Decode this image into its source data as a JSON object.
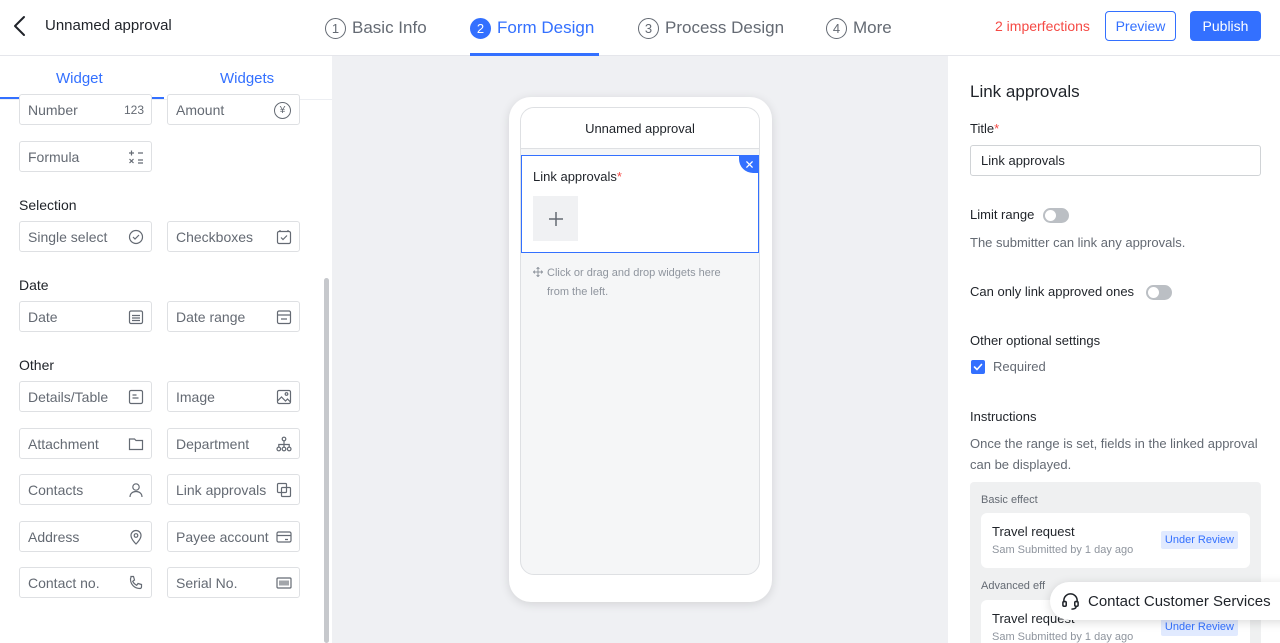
{
  "header": {
    "title": "Unnamed approval",
    "steps": [
      {
        "num": "1",
        "label": "Basic Info"
      },
      {
        "num": "2",
        "label": "Form Design"
      },
      {
        "num": "3",
        "label": "Process Design"
      },
      {
        "num": "4",
        "label": "More"
      }
    ],
    "imperfections": "2 imperfections",
    "preview": "Preview",
    "publish": "Publish"
  },
  "left": {
    "tabs": [
      "Widget",
      "Widgets"
    ],
    "sections": {
      "selection": "Selection",
      "date": "Date",
      "other": "Other"
    },
    "widgets": {
      "number": {
        "label": "Number",
        "icon": "123"
      },
      "amount": {
        "label": "Amount",
        "icon": "¥"
      },
      "formula": {
        "label": "Formula"
      },
      "single_select": {
        "label": "Single select"
      },
      "checkboxes": {
        "label": "Checkboxes"
      },
      "date": {
        "label": "Date"
      },
      "date_range": {
        "label": "Date range"
      },
      "details_table": {
        "label": "Details/Table"
      },
      "image": {
        "label": "Image"
      },
      "attachment": {
        "label": "Attachment"
      },
      "department": {
        "label": "Department"
      },
      "contacts": {
        "label": "Contacts"
      },
      "link_approvals": {
        "label": "Link approvals"
      },
      "address": {
        "label": "Address"
      },
      "payee_account": {
        "label": "Payee account"
      },
      "contact_no": {
        "label": "Contact no."
      },
      "serial_no": {
        "label": "Serial No."
      }
    }
  },
  "canvas": {
    "phone_title": "Unnamed approval",
    "field_label": "Link approvals",
    "required_mark": "*",
    "drop_hint": "Click or drag and drop widgets here from the left."
  },
  "right": {
    "title": "Link approvals",
    "title_label": "Title",
    "required_mark": "*",
    "title_value": "Link approvals",
    "limit_range": "Limit range",
    "limit_hint": "The submitter can link any approvals.",
    "only_approved": "Can only link approved ones",
    "other_settings": "Other optional settings",
    "required": "Required",
    "instructions": "Instructions",
    "instructions_text": "Once the range is set, fields in the linked approval can be displayed.",
    "basic_effect": "Basic effect",
    "advanced_effect": "Advanced eff",
    "cards": [
      {
        "title": "Travel request",
        "sub": "Sam Submitted by 1 day ago",
        "badge": "Under Review"
      },
      {
        "title": "Travel request",
        "sub": "Sam Submitted by 1 day ago",
        "badge": "Under Review"
      }
    ]
  },
  "support": {
    "label": "Contact Customer Services"
  },
  "colors": {
    "accent": "#3370ff",
    "danger": "#f54a45"
  }
}
